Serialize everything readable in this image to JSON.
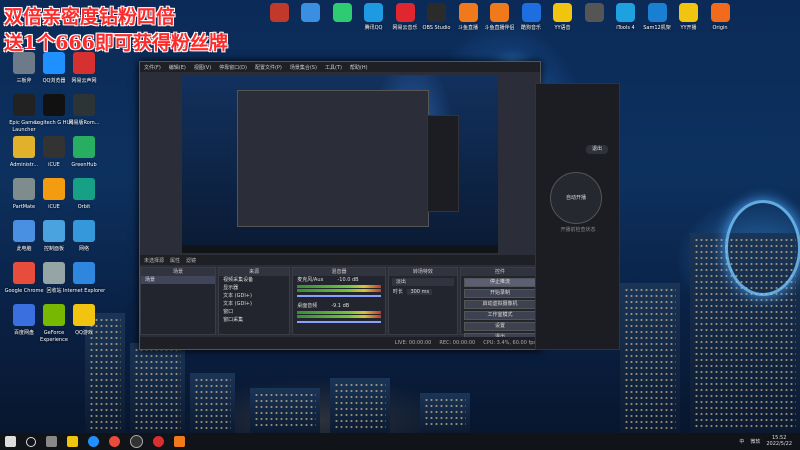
{
  "promo": {
    "line1": "双倍亲密度钻粉四倍",
    "line2": "送1个666即可获得粉丝牌"
  },
  "top_icons": [
    {
      "label": "",
      "color": "#c0392b"
    },
    {
      "label": "",
      "color": "#3a8fe0"
    },
    {
      "label": "",
      "color": "#2ecc71"
    },
    {
      "label": "腾讯QQ",
      "color": "#1e9be0"
    },
    {
      "label": "网易云音乐",
      "color": "#e0262e"
    },
    {
      "label": "OBS Studio",
      "color": "#2b2b2b"
    },
    {
      "label": "斗鱼直播",
      "color": "#f07a1b"
    },
    {
      "label": "斗鱼直播伴侣",
      "color": "#f07a1b"
    },
    {
      "label": "酷狗音乐",
      "color": "#1d6fe0"
    },
    {
      "label": "YY语音",
      "color": "#f1c40f"
    },
    {
      "label": "",
      "color": "#555555"
    },
    {
      "label": "iTools 4",
      "color": "#1da1e0"
    },
    {
      "label": "Sam12机架",
      "color": "#1a7fd0"
    },
    {
      "label": "YY开播",
      "color": "#f1c40f"
    },
    {
      "label": "Origin",
      "color": "#f26b1d"
    }
  ],
  "desktop_icons": [
    {
      "label": "三板斧",
      "color": "#6c7a89"
    },
    {
      "label": "QQ浏览器",
      "color": "#1e90ff"
    },
    {
      "label": "网易云声网",
      "color": "#d63031"
    },
    {
      "label": "Epic Games Launcher",
      "color": "#222222"
    },
    {
      "label": "Logitech G HUB",
      "color": "#111111"
    },
    {
      "label": "网易版Rom...",
      "color": "#2d3436"
    },
    {
      "label": "Administr...",
      "color": "#e1b12c"
    },
    {
      "label": "iCUE",
      "color": "#333333"
    },
    {
      "label": "GreenHub",
      "color": "#27ae60"
    },
    {
      "label": "PartMate",
      "color": "#7f8c8d"
    },
    {
      "label": "iCUE",
      "color": "#f39c12"
    },
    {
      "label": "Orbit",
      "color": "#16a085"
    },
    {
      "label": "此电脑",
      "color": "#4a90e2"
    },
    {
      "label": "控制面板",
      "color": "#4aa3df"
    },
    {
      "label": "网络",
      "color": "#3498db"
    },
    {
      "label": "Google Chrome",
      "color": "#e74c3c"
    },
    {
      "label": "回收站",
      "color": "#95a5a6"
    },
    {
      "label": "Internet Explorer",
      "color": "#2e86de"
    },
    {
      "label": "百度网盘",
      "color": "#3a6fe0"
    },
    {
      "label": "GeForce Experience",
      "color": "#76b900"
    },
    {
      "label": "QQ游戏",
      "color": "#f1c40f"
    }
  ],
  "obs": {
    "menu": [
      "文件(F)",
      "编辑(E)",
      "视图(V)",
      "停靠窗口(D)",
      "配置文件(P)",
      "场景集合(S)",
      "工具(T)",
      "帮助(H)"
    ],
    "scene_label": "未选择源",
    "scene_tabs": [
      "属性",
      "滤镜"
    ],
    "docks": {
      "scenes": {
        "title": "场景",
        "items": [
          "场景"
        ]
      },
      "sources": {
        "title": "来源",
        "items": [
          "视频采集设备",
          "显示器",
          "文本 (GDI+)",
          "文本 (GDI+)",
          "窗口",
          "窗口采集"
        ]
      },
      "mixer": {
        "title": "混音器",
        "channels": [
          {
            "name": "麦克风/Aux",
            "value": "-10.0 dB"
          },
          {
            "name": "桌面音频",
            "value": "-9.1 dB"
          }
        ]
      },
      "transitions": {
        "title": "转场特效",
        "mode": "淡出",
        "duration_label": "时长",
        "duration": "300 ms"
      },
      "controls": {
        "title": "控件",
        "buttons": [
          "停止推流",
          "开始录制",
          "启动虚拟摄像机",
          "工作室模式",
          "设置",
          "退出"
        ]
      }
    },
    "status": {
      "live": "LIVE: 00:00:00",
      "rec": "REC: 00:00:00",
      "cpu": "CPU: 3.4%, 60.00 fps"
    }
  },
  "right_app": {
    "button": "退出",
    "circle": "自动开播",
    "hint": "开播前检查状态"
  },
  "taskbar": {
    "clock_time": "15:52",
    "clock_date": "2022/5/22",
    "ime": "中",
    "weather": "微软"
  }
}
